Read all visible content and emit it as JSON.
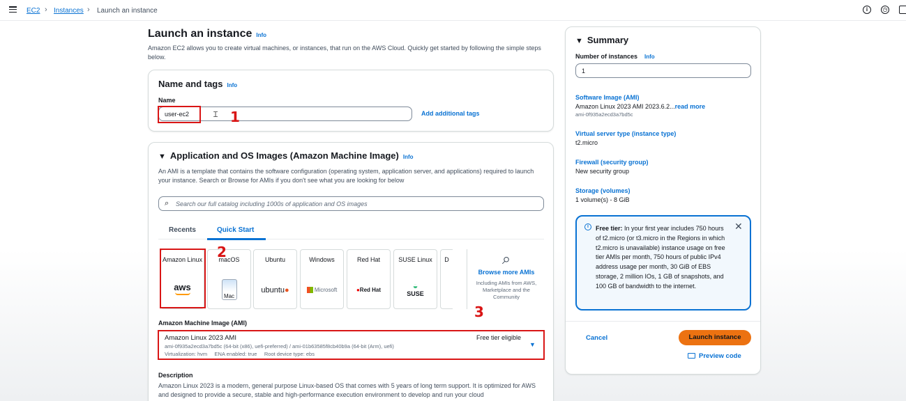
{
  "breadcrumb": {
    "root": "EC2",
    "section": "Instances",
    "current": "Launch an instance"
  },
  "page": {
    "title": "Launch an instance",
    "info": "Info",
    "description": "Amazon EC2 allows you to create virtual machines, or instances, that run on the AWS Cloud. Quickly get started by following the simple steps below."
  },
  "name_tags": {
    "title": "Name and tags",
    "info": "Info",
    "name_label": "Name",
    "name_value": "user-ec2",
    "add_tags": "Add additional tags"
  },
  "ami_section": {
    "title": "Application and OS Images (Amazon Machine Image)",
    "info": "Info",
    "description": "An AMI is a template that contains the software configuration (operating system, application server, and applications) required to launch your instance. Search or Browse for AMIs if you don't see what you are looking for below",
    "search_placeholder": "Search our full catalog including 1000s of application and OS images",
    "tabs": [
      "Recents",
      "Quick Start"
    ],
    "tiles": [
      {
        "label": "Amazon Linux",
        "logo": "aws"
      },
      {
        "label": "macOS",
        "logo": "Mac"
      },
      {
        "label": "Ubuntu",
        "logo": "ubuntu"
      },
      {
        "label": "Windows",
        "logo": "Microsoft"
      },
      {
        "label": "Red Hat",
        "logo": "Red Hat"
      },
      {
        "label": "SUSE Linux",
        "logo": "SUSE"
      },
      {
        "label": "D",
        "logo": ""
      }
    ],
    "browse_more": "Browse more AMIs",
    "browse_more_sub": "Including AMIs from AWS, Marketplace and the Community",
    "ami_label": "Amazon Machine Image (AMI)",
    "ami_name": "Amazon Linux 2023 AMI",
    "ami_ids": "ami-0f935a2ecd3a7bd5c (64-bit (x86), uefi-preferred) / ami-01b63585f8cb40b9a (64-bit (Arm), uefi)",
    "ami_meta": "Virtualization: hvm     ENA enabled: true     Root device type: ebs",
    "free_tier": "Free tier eligible",
    "description_label": "Description",
    "description_text": "Amazon Linux 2023 is a modern, general purpose Linux-based OS that comes with 5 years of long term support. It is optimized for AWS and designed to provide a secure, stable and high-performance execution environment to develop and run your cloud"
  },
  "summary": {
    "title": "Summary",
    "count_label": "Number of instances",
    "info": "Info",
    "count_value": "1",
    "software_label": "Software Image (AMI)",
    "software_value": "Amazon Linux 2023 AMI 2023.6.2...",
    "read_more": "read more",
    "software_id": "ami-0f935a2ecd3a7bd5c",
    "type_label": "Virtual server type (instance type)",
    "type_value": "t2.micro",
    "firewall_label": "Firewall (security group)",
    "firewall_value": "New security group",
    "storage_label": "Storage (volumes)",
    "storage_value": "1 volume(s) - 8 GiB",
    "free_tier_title": "Free tier:",
    "free_tier_text": "In your first year includes 750 hours of t2.micro (or t3.micro in the Regions in which t2.micro is unavailable) instance usage on free tier AMIs per month, 750 hours of public IPv4 address usage per month, 30 GiB of EBS storage, 2 million IOs, 1 GB of snapshots, and 100 GB of bandwidth to the internet.",
    "cancel": "Cancel",
    "launch": "Launch instance",
    "preview": "Preview code"
  },
  "annotations": [
    "1",
    "2",
    "3"
  ],
  "colors": {
    "accent": "#0972d3",
    "launch": "#ec7211",
    "annotation": "#d91515"
  }
}
